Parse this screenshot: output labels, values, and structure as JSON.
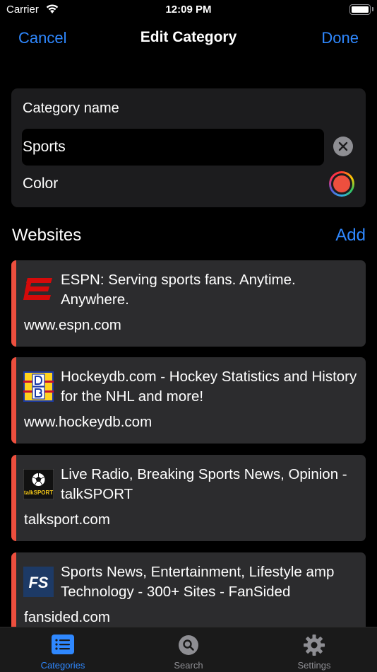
{
  "status_bar": {
    "carrier": "Carrier",
    "time": "12:09 PM"
  },
  "nav": {
    "cancel_label": "Cancel",
    "title": "Edit Category",
    "done_label": "Done"
  },
  "category": {
    "name_label": "Category name",
    "name_value": "Sports",
    "color_label": "Color",
    "color_value": "#ed4f3e"
  },
  "websites": {
    "section_title": "Websites",
    "add_label": "Add",
    "items": [
      {
        "title": "ESPN: Serving sports fans. Anytime. Anywhere.",
        "url": "www.espn.com",
        "icon": "espn-logo-icon"
      },
      {
        "title": "Hockeydb.com - Hockey Statistics and History for the NHL and more!",
        "url": "www.hockeydb.com",
        "icon": "hockeydb-logo-icon"
      },
      {
        "title": "Live Radio, Breaking Sports News, Opinion - talkSPORT",
        "url": "talksport.com",
        "icon": "talksport-logo-icon"
      },
      {
        "title": "Sports News, Entertainment, Lifestyle amp Technology - 300+ Sites - FanSided",
        "url": "fansided.com",
        "icon": "fansided-logo-icon"
      }
    ]
  },
  "tab_bar": {
    "tabs": [
      {
        "label": "Categories",
        "icon": "list-icon",
        "active": true
      },
      {
        "label": "Search",
        "icon": "search-icon",
        "active": false
      },
      {
        "label": "Settings",
        "icon": "gear-icon",
        "active": false
      }
    ]
  },
  "colors": {
    "accent": "#2f88ff",
    "category_color": "#ed4f3e",
    "card_bg": "#2c2c2e"
  }
}
